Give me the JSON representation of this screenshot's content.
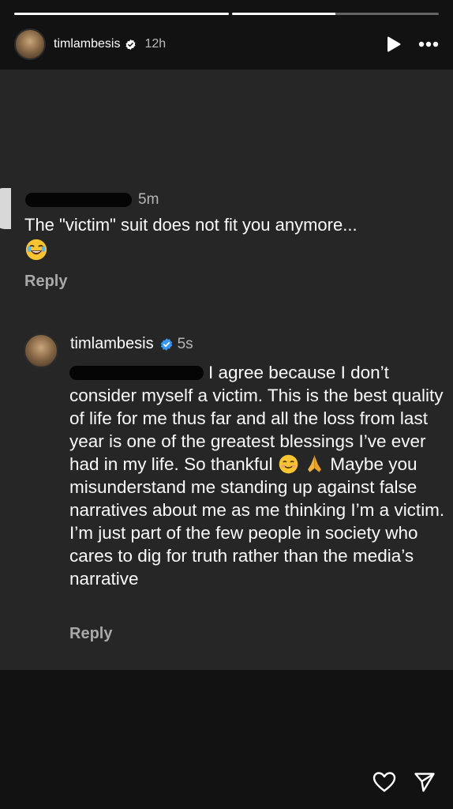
{
  "story": {
    "progress": [
      1.0,
      0.5
    ],
    "username": "timlambesis",
    "time_ago": "12h"
  },
  "comment": {
    "time_ago": "5m",
    "text": "The \"victim\" suit does not fit you anymore...",
    "reply_label": "Reply"
  },
  "reply": {
    "username": "timlambesis",
    "time_ago": "5s",
    "text_part1": "I agree because I don’t consider myself a victim. This is the best quality of life for me thus far and all the loss from last year is one of the greatest blessings I’ve ever had in my life. So thankful ",
    "text_part2": " Maybe you misunderstand me standing up against false narratives about me as me thinking I’m a victim. I’m just part of the few people in society who cares to dig for truth rather than the media’s narrative",
    "reply_label": "Reply"
  },
  "icons": [
    "verified-badge-icon",
    "play-icon",
    "more-icon",
    "laughing-emoji-icon",
    "smiling-emoji-icon",
    "praying-hands-emoji-icon",
    "heart-icon",
    "send-icon"
  ],
  "colors": {
    "verified": "#3897f0",
    "background": "#121212",
    "card": "#262626"
  }
}
